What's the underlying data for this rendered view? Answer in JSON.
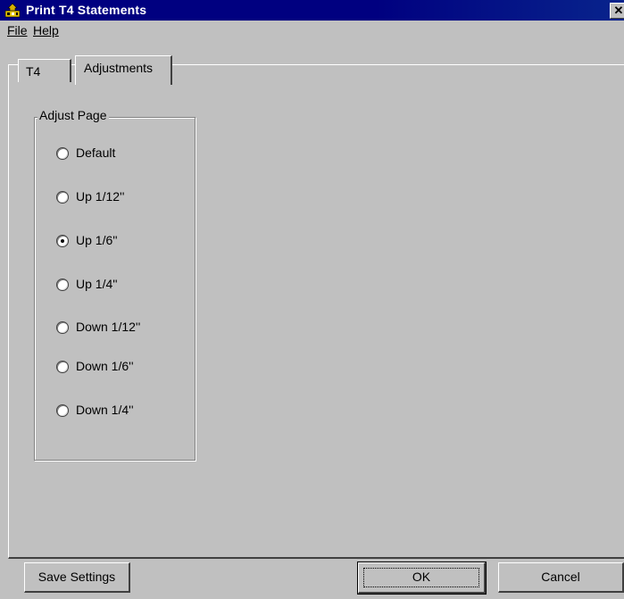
{
  "window": {
    "title": "Print T4 Statements",
    "close_glyph": "✕"
  },
  "menu": {
    "file": "File",
    "help": "Help"
  },
  "tabs": {
    "t4": "T4",
    "adjustments": "Adjustments"
  },
  "group": {
    "label": "Adjust Page",
    "options": [
      {
        "label": "Default",
        "selected": false
      },
      {
        "label": "Up 1/12''",
        "selected": false
      },
      {
        "label": "Up 1/6''",
        "selected": true
      },
      {
        "label": "Up 1/4''",
        "selected": false
      },
      {
        "label": "Down 1/12''",
        "selected": false
      },
      {
        "label": "Down 1/6''",
        "selected": false
      },
      {
        "label": "Down 1/4''",
        "selected": false
      }
    ]
  },
  "buttons": {
    "save": "Save Settings",
    "ok": "OK",
    "cancel": "Cancel"
  },
  "colors": {
    "titlebar": "#000080",
    "face": "#c0c0c0"
  },
  "icons": {
    "app": "printer-person-icon",
    "close": "close-icon"
  }
}
